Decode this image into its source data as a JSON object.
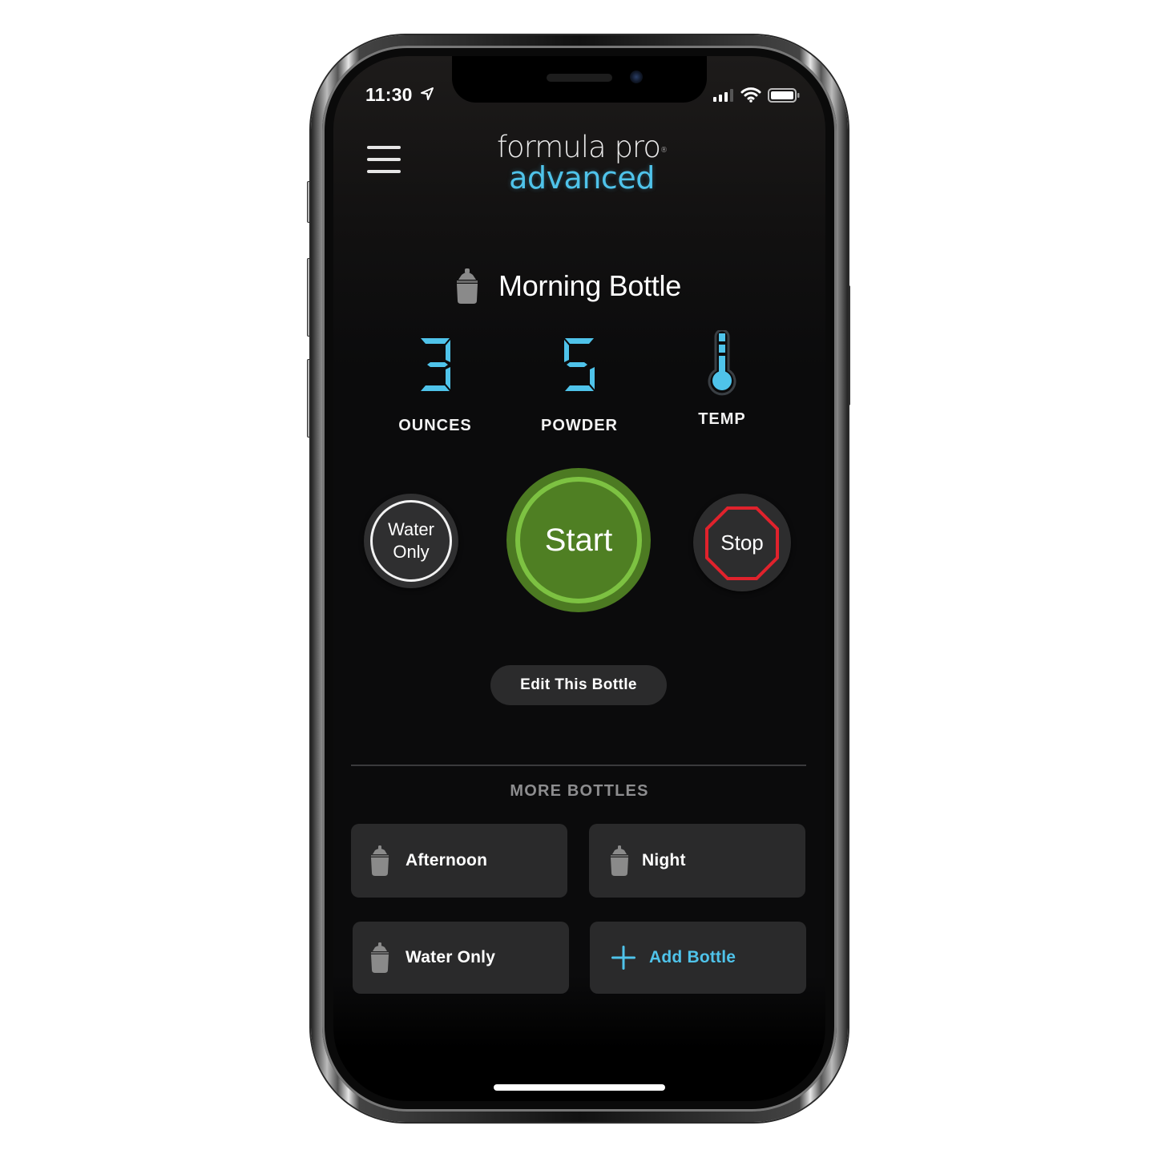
{
  "status_bar": {
    "time": "11:30",
    "location_icon": "location-arrow-icon",
    "signal_icon": "cellular-signal-icon",
    "wifi_icon": "wifi-icon",
    "battery_icon": "battery-icon"
  },
  "header": {
    "menu_icon": "hamburger-menu-icon",
    "logo_line1": "formula pro",
    "logo_registered": "®",
    "logo_line2": "advanced"
  },
  "current_bottle": {
    "icon": "baby-bottle-icon",
    "name": "Morning Bottle",
    "metrics": [
      {
        "label": "OUNCES",
        "value": "3"
      },
      {
        "label": "POWDER",
        "value": "5"
      },
      {
        "label": "TEMP",
        "icon": "thermometer-icon"
      }
    ]
  },
  "controls": {
    "water_only_line1": "Water",
    "water_only_line2": "Only",
    "start_label": "Start",
    "stop_label": "Stop",
    "edit_label": "Edit This Bottle"
  },
  "more_bottles": {
    "heading": "MORE BOTTLES",
    "items": [
      {
        "label": "Afternoon",
        "icon": "baby-bottle-icon"
      },
      {
        "label": "Night",
        "icon": "baby-bottle-icon"
      },
      {
        "label": "Water Only",
        "icon": "baby-bottle-icon"
      }
    ],
    "add_label": "Add Bottle",
    "add_icon": "plus-icon"
  },
  "colors": {
    "accent_blue": "#4fc3ea",
    "start_green": "#4f7f23",
    "start_ring": "#7dc242",
    "stop_red": "#e0222c",
    "card_bg": "#2a2a2b"
  }
}
